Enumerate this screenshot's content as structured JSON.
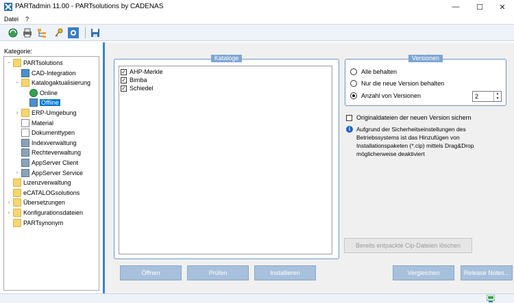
{
  "window": {
    "title": "PARTadmin 11.00 - PARTsolutions by CADENAS",
    "controls": {
      "minimize": "—",
      "maximize": "☐",
      "close": "✕"
    }
  },
  "menu": [
    "Datei",
    "?"
  ],
  "toolbar_icons": [
    "refresh-globe-icon",
    "printer-icon",
    "tree-hierarchy-icon",
    "keys-icon",
    "tools-icon",
    "save-disk-icon"
  ],
  "sidebar": {
    "label": "Kategorie:",
    "tree": [
      {
        "label": "PARTsolutions",
        "depth": 0,
        "icon": "folder",
        "expander": "−"
      },
      {
        "label": "CAD-Integration",
        "depth": 1,
        "icon": "sys",
        "expander": ""
      },
      {
        "label": "Katalogaktualisierung",
        "depth": 1,
        "icon": "folder",
        "expander": "−"
      },
      {
        "label": "Online",
        "depth": 2,
        "icon": "globe",
        "expander": ""
      },
      {
        "label": "Offline",
        "depth": 2,
        "icon": "sys",
        "expander": "",
        "selected": true
      },
      {
        "label": "ERP-Umgebung",
        "depth": 1,
        "icon": "folder",
        "expander": "›"
      },
      {
        "label": "Material",
        "depth": 1,
        "icon": "doc",
        "expander": ""
      },
      {
        "label": "Dokumenttypen",
        "depth": 1,
        "icon": "doc",
        "expander": ""
      },
      {
        "label": "Indexverwaltung",
        "depth": 1,
        "icon": "gear",
        "expander": ""
      },
      {
        "label": "Rechteverwaltung",
        "depth": 1,
        "icon": "gear",
        "expander": ""
      },
      {
        "label": "AppServer Client",
        "depth": 1,
        "icon": "gear",
        "expander": ""
      },
      {
        "label": "AppServer Service",
        "depth": 1,
        "icon": "gear",
        "expander": "›"
      },
      {
        "label": "Lizenzverwaltung",
        "depth": 0,
        "icon": "folder",
        "expander": ""
      },
      {
        "label": "eCATALOGsolutions",
        "depth": 0,
        "icon": "folder",
        "expander": ""
      },
      {
        "label": "Übersetzungen",
        "depth": 0,
        "icon": "folder",
        "expander": "›"
      },
      {
        "label": "Konfigurationsdateien",
        "depth": 0,
        "icon": "folder",
        "expander": "›"
      },
      {
        "label": "PARTsynonym",
        "depth": 0,
        "icon": "folder",
        "expander": ""
      }
    ]
  },
  "kataloge": {
    "title": "Kataloge",
    "items": [
      {
        "label": "AHP-Merkle",
        "checked": true
      },
      {
        "label": "Bimba",
        "checked": true
      },
      {
        "label": "Schiedel",
        "checked": true
      }
    ]
  },
  "versionen": {
    "title": "Versionen",
    "options": [
      {
        "label": "Alle behalten",
        "selected": false
      },
      {
        "label": "Nur die neue Version behalten",
        "selected": false
      },
      {
        "label": "Anzahl von Versionen",
        "selected": true
      }
    ],
    "count_value": "2"
  },
  "originals_checkbox": {
    "label": "Originaldateien der neuen Version sichern",
    "checked": false
  },
  "info_text": "Aufgrund der Sicherheitseinstellungen des Betriebssystems ist das Hinzufügen von Installationspaketen (*.cip) mittels Drag&Drop möglicherweise deaktiviert",
  "buttons": {
    "delete_cip": "Bereits entpackte Cip-Dateien löschen",
    "open": "Öffnen",
    "check": "Prüfen",
    "install": "Installieren",
    "compare": "Vergleichen",
    "release_notes": "Release Notes..."
  }
}
